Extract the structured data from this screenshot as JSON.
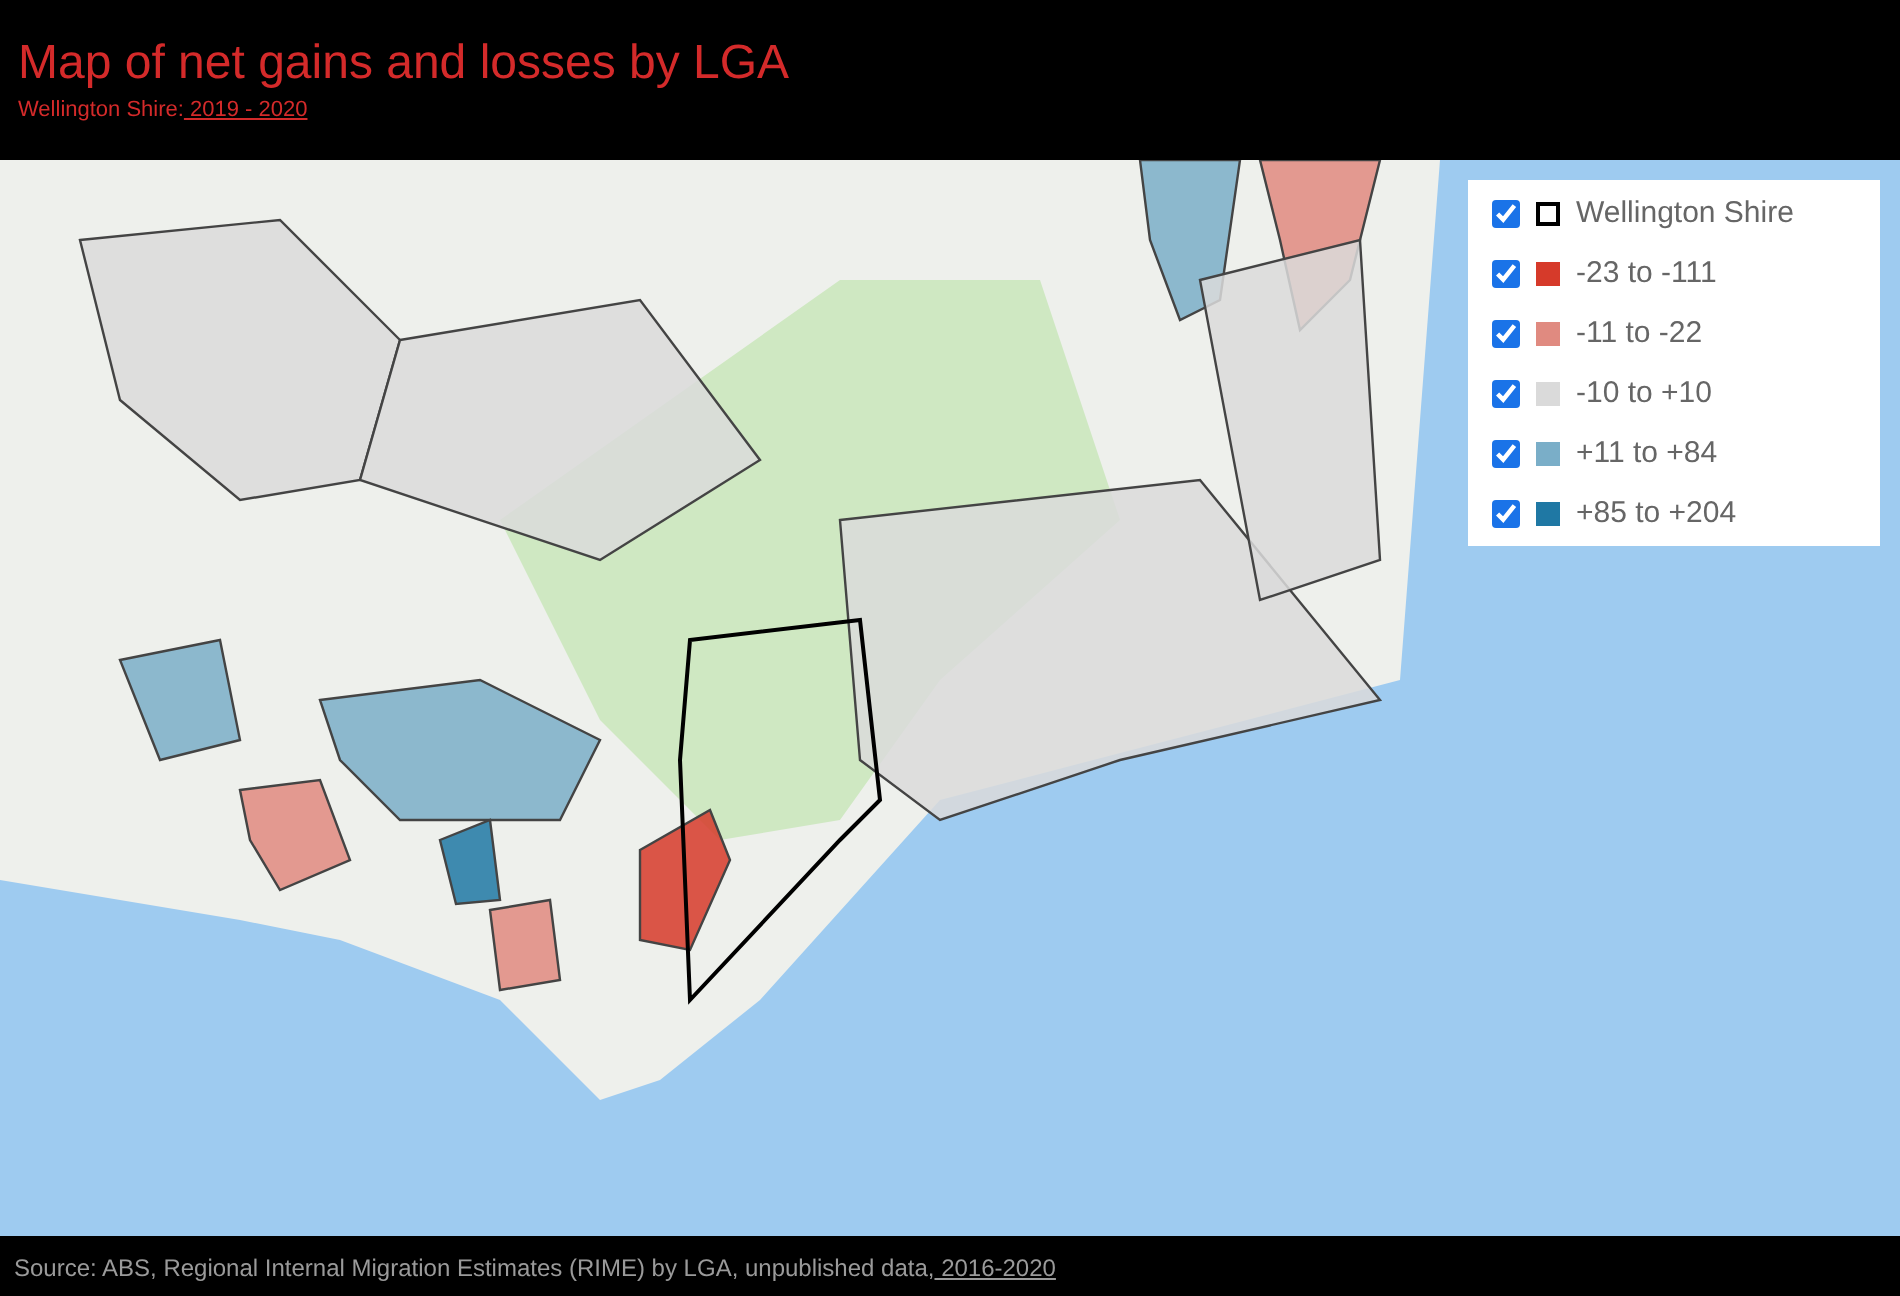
{
  "header": {
    "title": "Map of net gains and losses by LGA",
    "subtitle_label": "Wellington Shire:",
    "subtitle_period": " 2019 - 2020"
  },
  "legend": [
    {
      "kind": "outline",
      "label": "Wellington Shire",
      "checked": true,
      "color": "#000000"
    },
    {
      "kind": "fill",
      "label": "-23 to -111",
      "checked": true,
      "color": "#d63a2a"
    },
    {
      "kind": "fill",
      "label": "-11 to -22",
      "checked": true,
      "color": "#e08a80"
    },
    {
      "kind": "fill",
      "label": "-10 to +10",
      "checked": true,
      "color": "#dadada"
    },
    {
      "kind": "fill",
      "label": "+11 to +84",
      "checked": true,
      "color": "#7aaec8"
    },
    {
      "kind": "fill",
      "label": "+85 to +204",
      "checked": true,
      "color": "#1f78a4"
    }
  ],
  "footer": {
    "source": "Source: ABS, Regional Internal Migration Estimates (RIME) by LGA, unpublished data,",
    "period": " 2016-2020"
  }
}
